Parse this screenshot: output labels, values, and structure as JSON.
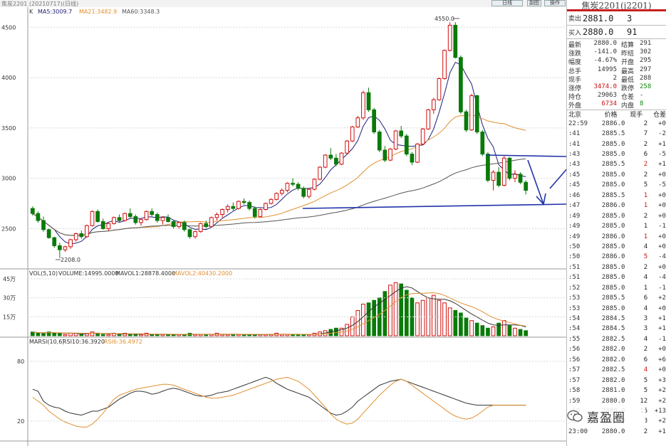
{
  "window": {
    "title": "焦炭2201 (20210717)(日线)",
    "buttons": [
      "日线",
      "副图",
      "操作"
    ]
  },
  "main_chart": {
    "label": "K",
    "ma_legend": [
      {
        "text": "MA5:3009.7",
        "color": "#1d1d7a"
      },
      {
        "text": "MA21:3482.9",
        "color": "#e09030"
      },
      {
        "text": "MA60:3348.3",
        "color": "#555555"
      }
    ],
    "price_axis": [
      "4500",
      "4000",
      "3500",
      "3000",
      "2500"
    ],
    "high_label": "4550.0",
    "low_label": "2208.0"
  },
  "volume_chart": {
    "legend": [
      {
        "text": "VOL(5,10)",
        "color": "#333333"
      },
      {
        "text": "VOLUME:14995.0000",
        "color": "#333333"
      },
      {
        "text": "MAVOL1:28878.4000",
        "color": "#333333"
      },
      {
        "text": "MAVOL2:40430.2000",
        "color": "#e09030"
      }
    ],
    "axis": [
      "45万",
      "30万",
      "15万"
    ]
  },
  "rsi_chart": {
    "legend": [
      {
        "text": "MARSI(10,6)",
        "color": "#333333"
      },
      {
        "text": "RSI10:36.3920",
        "color": "#333333"
      },
      {
        "text": "RSI6:36.4972",
        "color": "#e09030"
      }
    ],
    "axis": [
      "80",
      "20"
    ]
  },
  "chart_data": {
    "type": "candlestick",
    "title": "焦炭2201",
    "ylim": [
      2100,
      4700
    ],
    "candles": [
      [
        2700,
        2720,
        2630,
        2650
      ],
      [
        2650,
        2670,
        2560,
        2580
      ],
      [
        2580,
        2620,
        2470,
        2490
      ],
      [
        2490,
        2500,
        2400,
        2410
      ],
      [
        2410,
        2420,
        2310,
        2330
      ],
      [
        2330,
        2360,
        2208,
        2290
      ],
      [
        2290,
        2330,
        2270,
        2320
      ],
      [
        2320,
        2400,
        2300,
        2390
      ],
      [
        2390,
        2460,
        2370,
        2450
      ],
      [
        2450,
        2480,
        2400,
        2420
      ],
      [
        2420,
        2540,
        2410,
        2530
      ],
      [
        2530,
        2680,
        2520,
        2670
      ],
      [
        2670,
        2690,
        2560,
        2570
      ],
      [
        2570,
        2600,
        2490,
        2500
      ],
      [
        2500,
        2560,
        2480,
        2550
      ],
      [
        2550,
        2620,
        2540,
        2610
      ],
      [
        2610,
        2640,
        2560,
        2580
      ],
      [
        2580,
        2660,
        2570,
        2650
      ],
      [
        2650,
        2700,
        2600,
        2620
      ],
      [
        2620,
        2640,
        2540,
        2560
      ],
      [
        2560,
        2600,
        2530,
        2590
      ],
      [
        2590,
        2680,
        2580,
        2670
      ],
      [
        2670,
        2700,
        2620,
        2640
      ],
      [
        2640,
        2660,
        2560,
        2580
      ],
      [
        2580,
        2620,
        2540,
        2610
      ],
      [
        2610,
        2640,
        2560,
        2570
      ],
      [
        2570,
        2580,
        2500,
        2520
      ],
      [
        2520,
        2570,
        2500,
        2560
      ],
      [
        2560,
        2580,
        2470,
        2490
      ],
      [
        2490,
        2500,
        2400,
        2420
      ],
      [
        2420,
        2480,
        2400,
        2470
      ],
      [
        2470,
        2560,
        2460,
        2550
      ],
      [
        2550,
        2580,
        2500,
        2520
      ],
      [
        2520,
        2620,
        2510,
        2610
      ],
      [
        2610,
        2660,
        2580,
        2640
      ],
      [
        2640,
        2700,
        2610,
        2690
      ],
      [
        2690,
        2740,
        2660,
        2720
      ],
      [
        2720,
        2760,
        2680,
        2700
      ],
      [
        2700,
        2780,
        2690,
        2770
      ],
      [
        2770,
        2800,
        2740,
        2760
      ],
      [
        2760,
        2780,
        2680,
        2700
      ],
      [
        2700,
        2720,
        2600,
        2620
      ],
      [
        2620,
        2700,
        2610,
        2690
      ],
      [
        2690,
        2760,
        2680,
        2750
      ],
      [
        2750,
        2800,
        2740,
        2790
      ],
      [
        2790,
        2860,
        2780,
        2850
      ],
      [
        2850,
        2900,
        2830,
        2880
      ],
      [
        2880,
        2960,
        2860,
        2950
      ],
      [
        2950,
        3000,
        2920,
        2940
      ],
      [
        2940,
        2960,
        2880,
        2900
      ],
      [
        2900,
        2920,
        2800,
        2820
      ],
      [
        2820,
        2900,
        2800,
        2890
      ],
      [
        2890,
        3000,
        2880,
        2990
      ],
      [
        2990,
        3120,
        2980,
        3110
      ],
      [
        3110,
        3240,
        3100,
        3230
      ],
      [
        3230,
        3300,
        3180,
        3200
      ],
      [
        3200,
        3240,
        3120,
        3140
      ],
      [
        3140,
        3260,
        3130,
        3250
      ],
      [
        3250,
        3380,
        3240,
        3370
      ],
      [
        3370,
        3520,
        3360,
        3510
      ],
      [
        3510,
        3620,
        3500,
        3600
      ],
      [
        3600,
        3870,
        3580,
        3850
      ],
      [
        3850,
        3900,
        3660,
        3680
      ],
      [
        3680,
        3700,
        3440,
        3460
      ],
      [
        3460,
        3480,
        3260,
        3280
      ],
      [
        3280,
        3320,
        3160,
        3180
      ],
      [
        3180,
        3300,
        3170,
        3290
      ],
      [
        3290,
        3480,
        3280,
        3470
      ],
      [
        3470,
        3520,
        3400,
        3420
      ],
      [
        3420,
        3440,
        3220,
        3240
      ],
      [
        3240,
        3260,
        3130,
        3160
      ],
      [
        3160,
        3350,
        3150,
        3340
      ],
      [
        3340,
        3500,
        3330,
        3490
      ],
      [
        3490,
        3690,
        3480,
        3680
      ],
      [
        3680,
        3800,
        3640,
        3780
      ],
      [
        3780,
        4000,
        3770,
        3990
      ],
      [
        3990,
        4280,
        3980,
        4270
      ],
      [
        4270,
        4550,
        4260,
        4520
      ],
      [
        4520,
        4550,
        4190,
        4200
      ],
      [
        4200,
        4220,
        3640,
        3660
      ],
      [
        3660,
        3680,
        3460,
        3480
      ],
      [
        3480,
        3840,
        3470,
        3820
      ],
      [
        3820,
        3830,
        3440,
        3460
      ],
      [
        3460,
        3480,
        3220,
        3240
      ],
      [
        3240,
        3260,
        2960,
        2980
      ],
      [
        2980,
        3080,
        2880,
        3060
      ],
      [
        3060,
        3110,
        2910,
        2930
      ],
      [
        2930,
        3220,
        2920,
        3200
      ],
      [
        3200,
        3210,
        2980,
        3000
      ],
      [
        3000,
        3080,
        2960,
        3040
      ],
      [
        3040,
        3060,
        2940,
        2960
      ],
      [
        2960,
        2980,
        2840,
        2880
      ]
    ],
    "volume": [
      3,
      2,
      2,
      3,
      2,
      2,
      1,
      2,
      2,
      1,
      2,
      3,
      2,
      1,
      1,
      2,
      1,
      2,
      1,
      1,
      1,
      2,
      1,
      1,
      1,
      1,
      1,
      1,
      1,
      2,
      1,
      1,
      1,
      1,
      2,
      1,
      1,
      1,
      1,
      1,
      1,
      1,
      1,
      1,
      1,
      2,
      1,
      1,
      1,
      1,
      1,
      1,
      2,
      3,
      4,
      5,
      6,
      6,
      9,
      15,
      20,
      25,
      26,
      28,
      30,
      35,
      40,
      42,
      41,
      36,
      30,
      26,
      28,
      30,
      32,
      28,
      26,
      22,
      20,
      18,
      14,
      12,
      10,
      8,
      6,
      7,
      10,
      12,
      8,
      6,
      5,
      4
    ],
    "rsi10": [
      52,
      50,
      40,
      36,
      34,
      33,
      30,
      28,
      27,
      26,
      28,
      30,
      30,
      32,
      34,
      38,
      42,
      45,
      48,
      50,
      50,
      49,
      47,
      48,
      50,
      52,
      53,
      52,
      50,
      48,
      46,
      45,
      45,
      46,
      48,
      49,
      50,
      52,
      54,
      56,
      58,
      60,
      62,
      64,
      62,
      58,
      55,
      52,
      50,
      48,
      46,
      44,
      40,
      36,
      32,
      28,
      26,
      27,
      30,
      34,
      40,
      44,
      48,
      52,
      56,
      58,
      60,
      61,
      62,
      60,
      58,
      56,
      54,
      52,
      50,
      48,
      46,
      44,
      42,
      40,
      38,
      37,
      36,
      36,
      36,
      36,
      36,
      36,
      36,
      36,
      36,
      36
    ],
    "rsi6": [
      44,
      40,
      36,
      30,
      26,
      22,
      19,
      17,
      15,
      14,
      14,
      17,
      22,
      28,
      35,
      42,
      46,
      48,
      50,
      52,
      53,
      54,
      55,
      56,
      57,
      57,
      56,
      54,
      52,
      50,
      48,
      46,
      44,
      43,
      43,
      44,
      45,
      46,
      48,
      50,
      52,
      54,
      56,
      58,
      60,
      62,
      63,
      64,
      62,
      60,
      56,
      52,
      46,
      40,
      34,
      27,
      22,
      19,
      17,
      18,
      22,
      28,
      34,
      40,
      46,
      51,
      56,
      60,
      62,
      60,
      56,
      52,
      48,
      44,
      40,
      36,
      32,
      28,
      25,
      23,
      22,
      23,
      26,
      30,
      34,
      36,
      36,
      36,
      36,
      36,
      36,
      36
    ]
  },
  "quote_panel": {
    "title": "焦炭2201(j2201)",
    "ask": {
      "label": "卖出",
      "price": "2881.0",
      "vol": "3"
    },
    "bid": {
      "label": "买入",
      "price": "2880.0",
      "vol": "91"
    },
    "stats": [
      {
        "l": "最新",
        "v": "2880.0",
        "l2": "结算",
        "v2": "291"
      },
      {
        "l": "涨跌",
        "v": "-141.0",
        "l2": "昨结",
        "v2": "302"
      },
      {
        "l": "幅度",
        "v": "-4.67%",
        "l2": "开盘",
        "v2": "295"
      },
      {
        "l": "总手",
        "v": "14995",
        "l2": "最高",
        "v2": "297"
      },
      {
        "l": "现手",
        "v": "2",
        "l2": "最低",
        "v2": "288"
      },
      {
        "l": "涨停",
        "v": "3474.0",
        "l2": "跌停",
        "v2": "258",
        "vcolor": "red",
        "v2color": "green"
      },
      {
        "l": "持仓",
        "v": "29063",
        "l2": "仓差",
        "v2": "-"
      },
      {
        "l": "外盘",
        "v": "6734",
        "l2": "内盘",
        "v2": "8",
        "vcolor": "red",
        "v2color": "green"
      }
    ],
    "tick_header": [
      "北京",
      "价格",
      "现手",
      "仓差"
    ],
    "ticks": [
      {
        "t": "22:59",
        "p": "2886.0",
        "v": "2",
        "vc": "",
        "c": "+0"
      },
      {
        "t": ":41",
        "p": "2885.5",
        "v": "7",
        "vc": "",
        "c": "-2"
      },
      {
        "t": ":41",
        "p": "2885.0",
        "v": "2",
        "vc": "",
        "c": "+1"
      },
      {
        "t": ":43",
        "p": "2885.0",
        "v": "6",
        "vc": "",
        "c": "-5"
      },
      {
        "t": ":43",
        "p": "2885.5",
        "v": "2",
        "vc": "red",
        "c": "+1"
      },
      {
        "t": ":45",
        "p": "2885.0",
        "v": "2",
        "vc": "",
        "c": "+0"
      },
      {
        "t": ":45",
        "p": "2885.0",
        "v": "5",
        "vc": "",
        "c": "-5"
      },
      {
        "t": ":46",
        "p": "2885.5",
        "v": "1",
        "vc": "red",
        "c": "+0"
      },
      {
        "t": ":47",
        "p": "2886.0",
        "v": "1",
        "vc": "red",
        "c": "+0"
      },
      {
        "t": ":49",
        "p": "2885.0",
        "v": "2",
        "vc": "",
        "c": "+0"
      },
      {
        "t": ":49",
        "p": "2885.0",
        "v": "1",
        "vc": "",
        "c": "-1"
      },
      {
        "t": ":49",
        "p": "2886.0",
        "v": "1",
        "vc": "red",
        "c": "+0"
      },
      {
        "t": ":50",
        "p": "2885.0",
        "v": "4",
        "vc": "",
        "c": "+0"
      },
      {
        "t": ":50",
        "p": "2886.0",
        "v": "5",
        "vc": "red",
        "c": "-4"
      },
      {
        "t": ":51",
        "p": "2885.0",
        "v": "2",
        "vc": "",
        "c": "+0"
      },
      {
        "t": ":51",
        "p": "2885.0",
        "v": "4",
        "vc": "",
        "c": "-4"
      },
      {
        "t": ":52",
        "p": "2885.0",
        "v": "1",
        "vc": "",
        "c": "-1"
      },
      {
        "t": ":53",
        "p": "2885.5",
        "v": "6",
        "vc": "",
        "c": "+2"
      },
      {
        "t": ":53",
        "p": "2885.0",
        "v": "4",
        "vc": "",
        "c": "+0"
      },
      {
        "t": ":54",
        "p": "2884.5",
        "v": "3",
        "vc": "",
        "c": "+1"
      },
      {
        "t": ":54",
        "p": "2884.5",
        "v": "3",
        "vc": "",
        "c": "+1"
      },
      {
        "t": ":55",
        "p": "2882.5",
        "v": "4",
        "vc": "",
        "c": "-1"
      },
      {
        "t": ":56",
        "p": "2882.0",
        "v": "2",
        "vc": "",
        "c": "+0"
      },
      {
        "t": ":56",
        "p": "2882.0",
        "v": "6",
        "vc": "",
        "c": "+6"
      },
      {
        "t": ":57",
        "p": "2882.5",
        "v": "4",
        "vc": "red",
        "c": "+0"
      },
      {
        "t": ":57",
        "p": "2882.0",
        "v": "5",
        "vc": "",
        "c": "+3"
      },
      {
        "t": ":58",
        "p": "2881.0",
        "v": "5",
        "vc": "",
        "c": "+2"
      },
      {
        "t": ":59",
        "p": "2880.0",
        "v": "12",
        "vc": "",
        "c": "+2"
      },
      {
        "t": ":59",
        "p": "2880.0",
        "v": "15",
        "vc": "",
        "c": "+13"
      },
      {
        "t": ":59",
        "p": "2880.0",
        "v": "3",
        "vc": "",
        "c": "+2"
      },
      {
        "t": "23:00",
        "p": "2880.0",
        "v": "2",
        "vc": "",
        "c": "+1"
      }
    ]
  },
  "watermark": {
    "text": "嘉盈圈"
  }
}
